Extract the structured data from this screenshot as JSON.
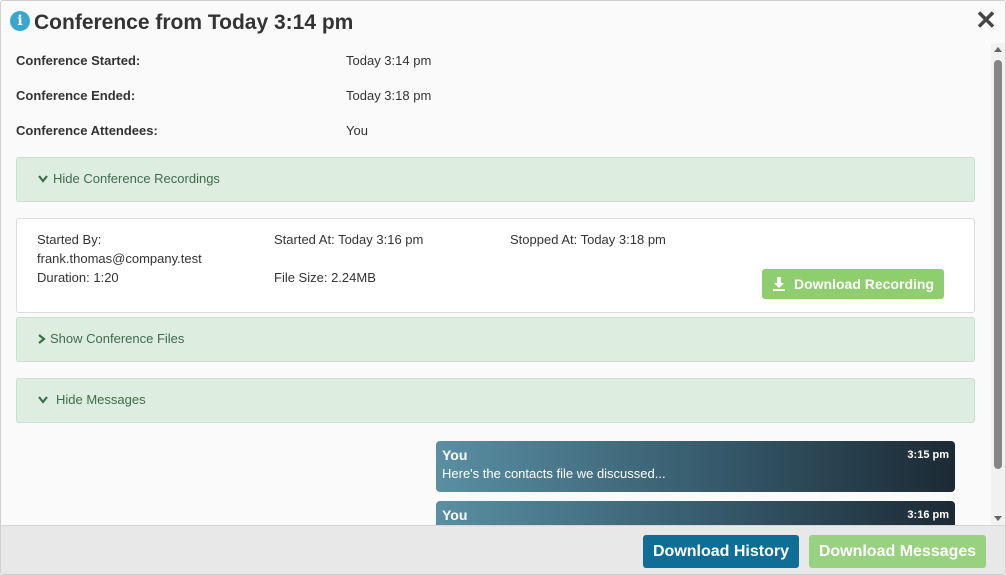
{
  "dialog": {
    "title": "Conference from Today 3:14 pm",
    "close_label": "✕"
  },
  "details": [
    {
      "label": "Conference Started:",
      "value": "Today 3:14 pm"
    },
    {
      "label": "Conference Ended:",
      "value": "Today 3:18 pm"
    },
    {
      "label": "Conference Attendees:",
      "value": "You"
    }
  ],
  "sections": {
    "recordings_toggle": "Hide Conference Recordings",
    "files_toggle": "Show Conference Files",
    "messages_toggle": "Hide Messages"
  },
  "recording": {
    "started_by_label": "Started By:",
    "started_by_value": "frank.thomas@company.test",
    "duration": "Duration: 1:20",
    "started_at": "Started At: Today 3:16 pm",
    "file_size": "File Size: 2.24MB",
    "stopped_at": "Stopped At: Today 3:18 pm",
    "download_label": "Download Recording"
  },
  "messages": [
    {
      "sender": "You",
      "time": "3:15 pm",
      "text": "Here's the contacts file we discussed..."
    },
    {
      "sender": "You",
      "time": "3:16 pm",
      "text": ""
    }
  ],
  "footer": {
    "download_history": "Download History",
    "download_messages": "Download Messages"
  },
  "colors": {
    "accent_blue": "#0f6e96",
    "accent_green": "#8fce6e",
    "panel_green": "#ddeee0",
    "info_blue": "#3aa6d0"
  },
  "icons": [
    "info-icon",
    "close-icon",
    "chevron-down-icon",
    "chevron-right-icon",
    "download-icon"
  ]
}
